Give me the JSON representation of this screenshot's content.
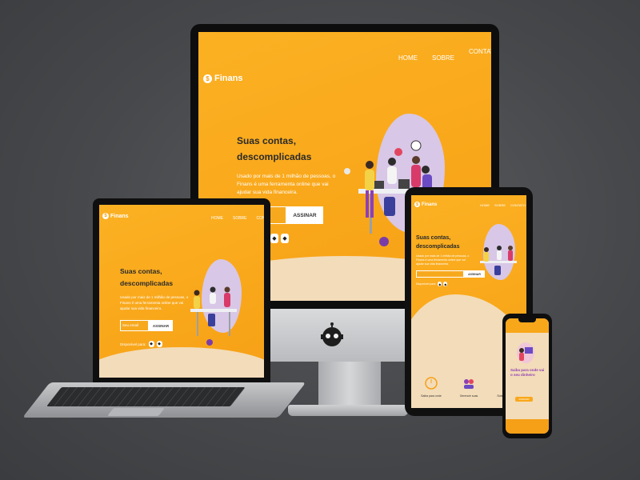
{
  "brand": {
    "name": "Finans",
    "logo_glyph": "$"
  },
  "nav": {
    "home": "HOME",
    "about": "SOBRE",
    "contact": "CONTATO"
  },
  "hero": {
    "title_line1": "Suas contas,",
    "title_line2": "descomplicadas",
    "desc_line1": "Usado por mais de 1 milhão de pessoas, o",
    "desc_line2": "Finans é uma ferramenta online que vai",
    "desc_line3": "ajudar sua vida financeira.",
    "input_placeholder": "Seu email",
    "button_label": "ASSINAR",
    "available_label": "Disponível para:"
  },
  "phone": {
    "title_line1": "Saiba para onde vai",
    "title_line2": "o seu dinheiro",
    "button_label": "ASSINAR"
  },
  "tablet_features": [
    "Saiba para onde",
    "Gerencie suas",
    "Sobre finanças"
  ],
  "colors": {
    "brand_orange": "#f9a71a",
    "cream": "#f3dcb9",
    "lilac": "#d8c7e6"
  }
}
